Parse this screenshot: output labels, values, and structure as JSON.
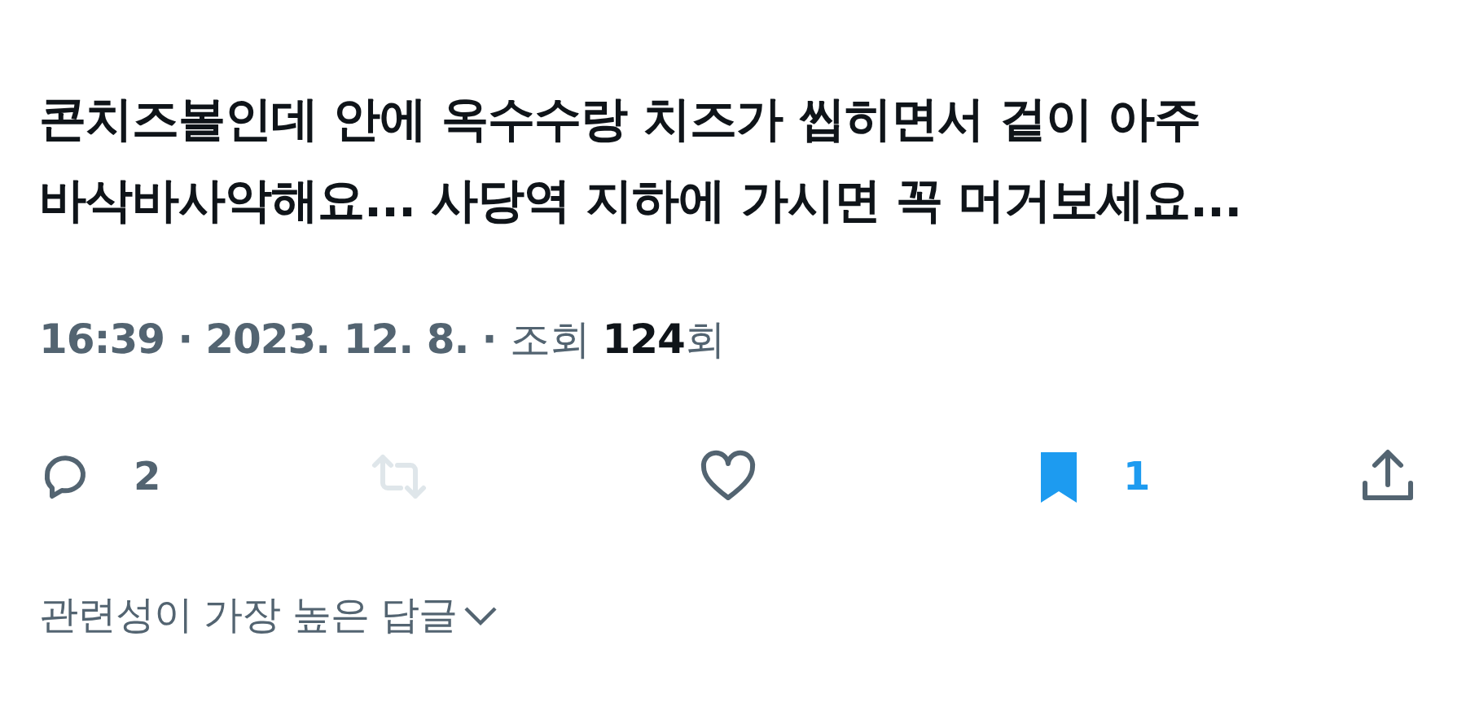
{
  "tweet": {
    "text": "콘치즈볼인데 안에 옥수수랑 치즈가 씹히면서 겉이 아주 바삭바사악해요... 사당역 지하에 가시면 꼭 머거보세요...",
    "meta": [
      {
        "kind": "time",
        "text": "16:39"
      },
      {
        "kind": "separator",
        "text": "·"
      },
      {
        "kind": "date",
        "text": "2023. 12. 8."
      },
      {
        "kind": "separator",
        "text": "·"
      },
      {
        "kind": "views-label",
        "text": "조회"
      },
      {
        "kind": "views-count",
        "text": "124"
      },
      {
        "kind": "views-unit",
        "text": "회"
      }
    ],
    "actions": [
      {
        "kind": "reply",
        "count": "2",
        "on": false,
        "disabled": false
      },
      {
        "kind": "retweet",
        "on": false,
        "disabled": true
      },
      {
        "kind": "like",
        "on": false,
        "disabled": false
      },
      {
        "kind": "bookmark",
        "count": "1",
        "on": true,
        "disabled": false
      },
      {
        "kind": "share",
        "on": false,
        "disabled": false
      }
    ]
  },
  "replies_sort": {
    "label": "관련성이 가장 높은 답글"
  }
}
